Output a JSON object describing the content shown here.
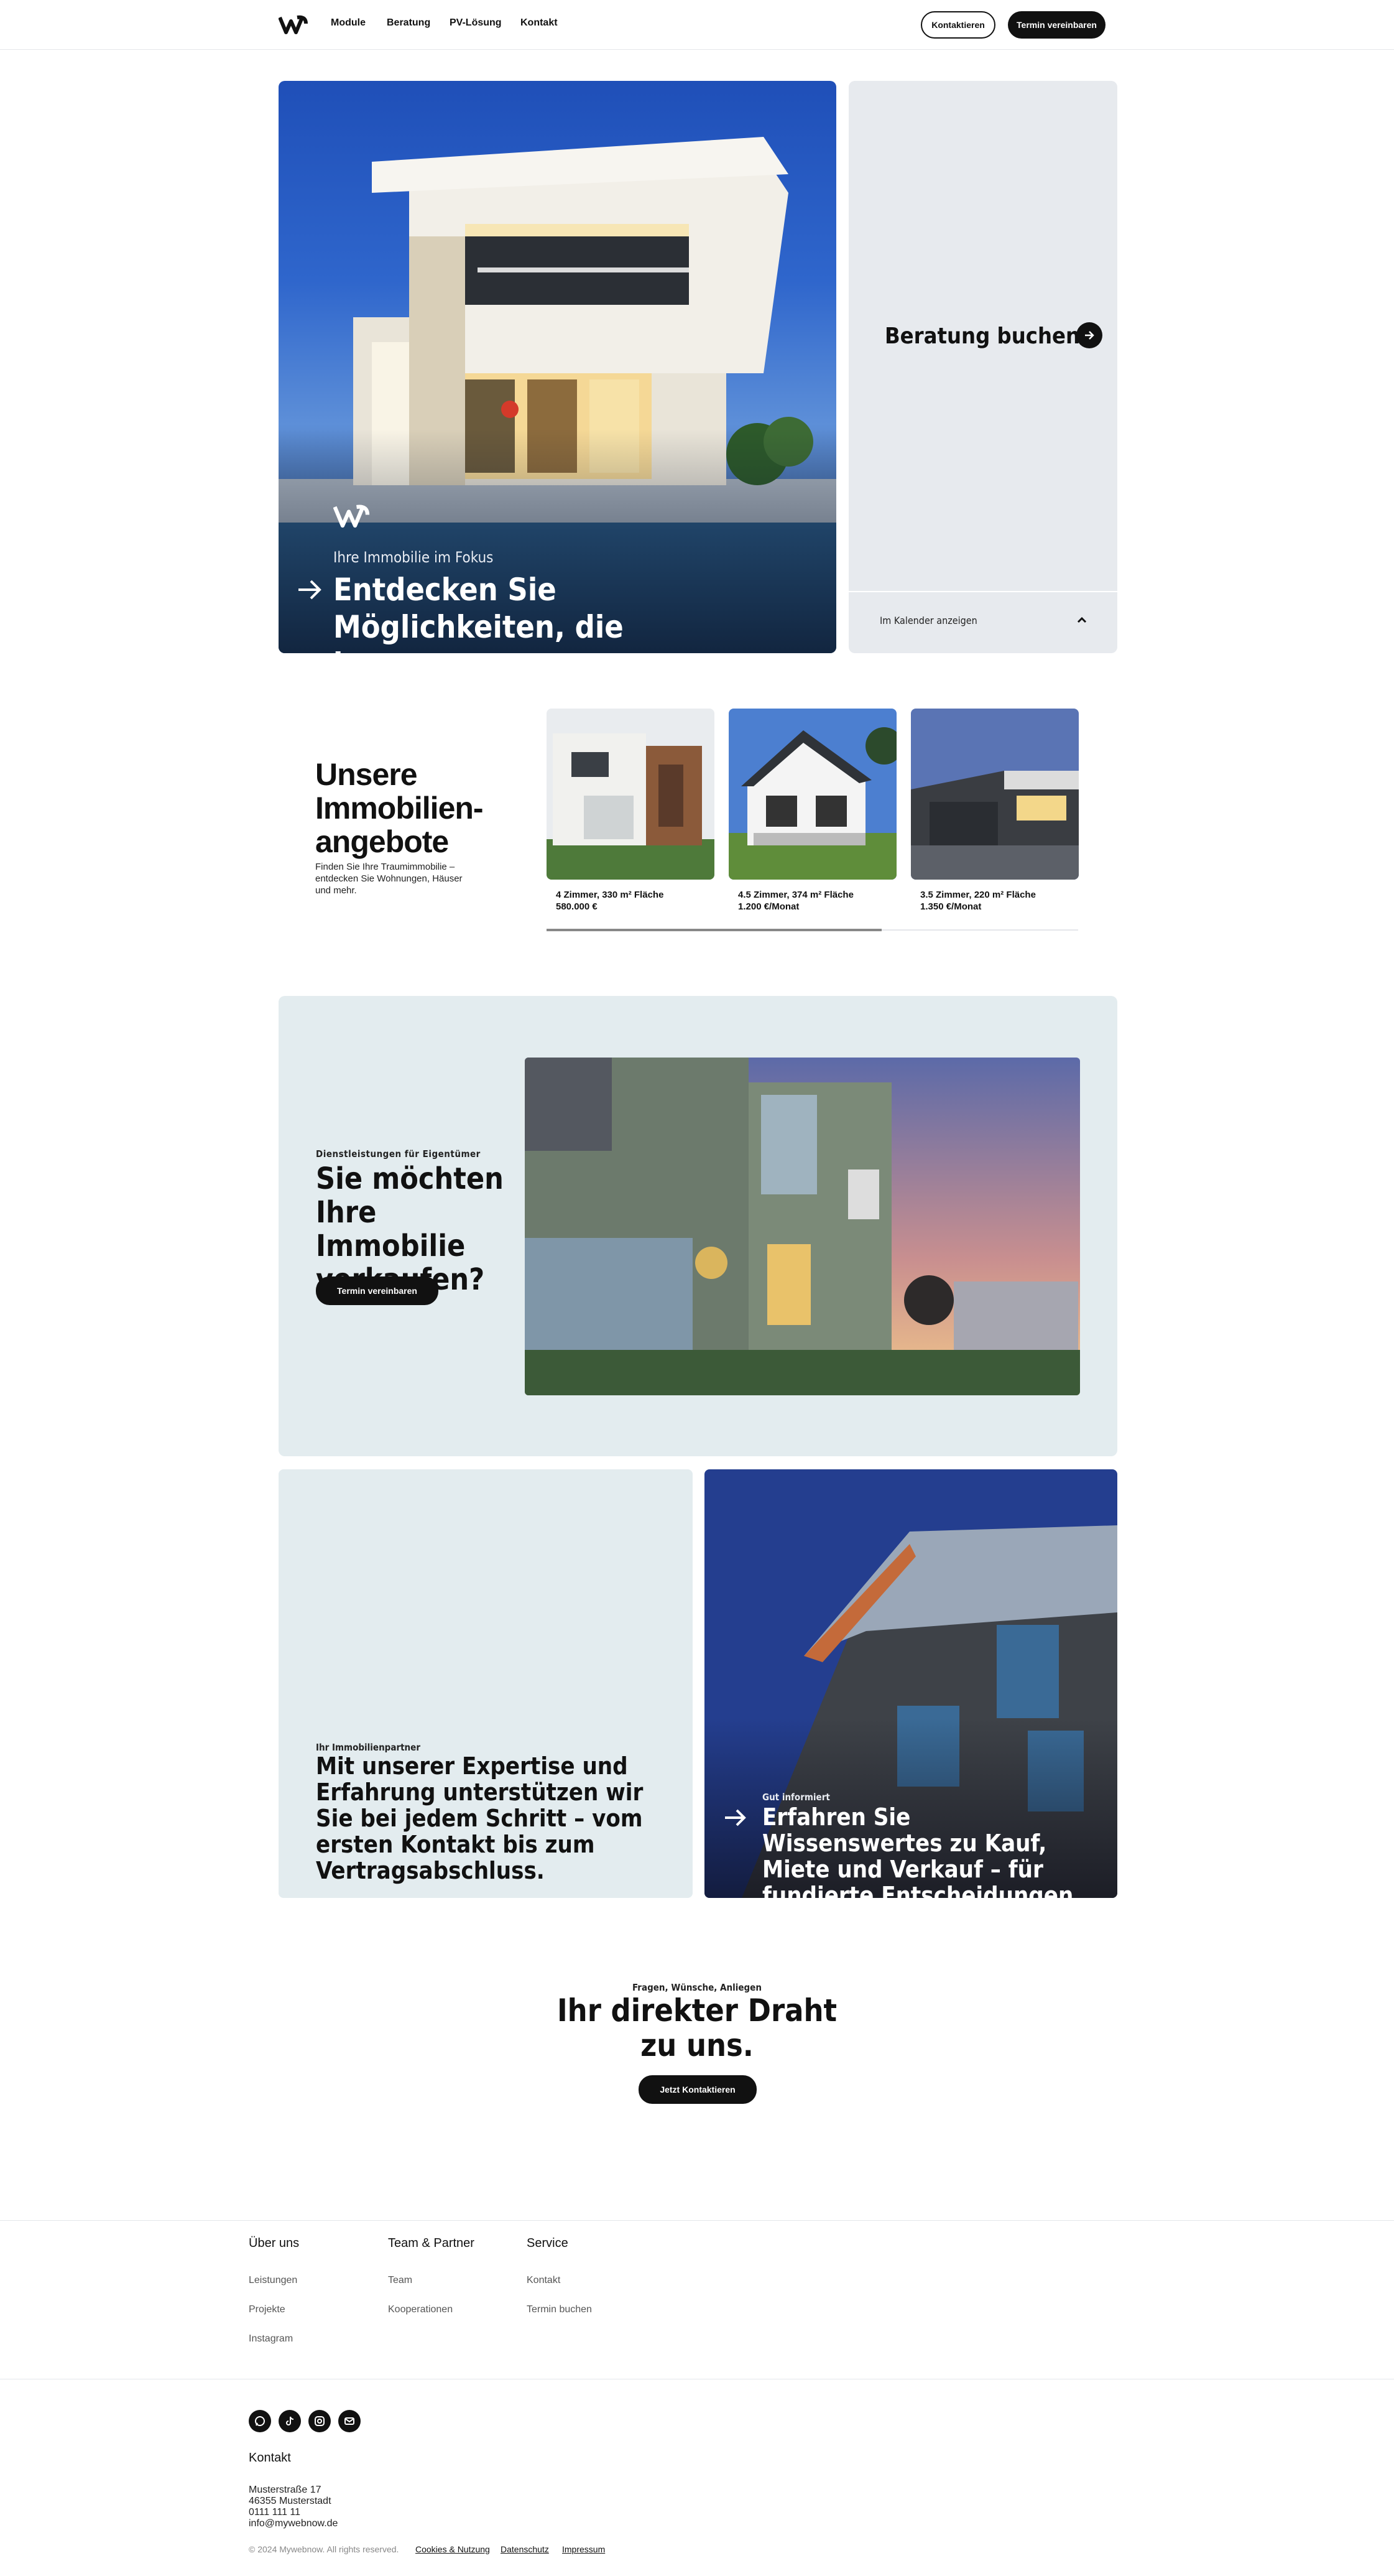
{
  "nav": {
    "links": [
      "Module",
      "Beratung",
      "PV-Lösung",
      "Kontakt"
    ],
    "contact_button": "Kontaktieren",
    "appointment_button": "Termin vereinbaren"
  },
  "hero": {
    "subtitle": "Ihre Immobilie im Fokus",
    "title": "Entdecken Sie Möglichkeiten, die bewegen."
  },
  "booking": {
    "title": "Beratung buchen",
    "calendar_label": "Im Kalender anzeigen"
  },
  "offers": {
    "title": "Unsere Immobilien-angebote",
    "description": "Finden Sie Ihre Traumimmobilie – entdecken Sie Wohnungen, Häuser und mehr.",
    "cards": [
      {
        "details": "4 Zimmer, 330 m² Fläche",
        "price": "580.000 €"
      },
      {
        "details": "4.5 Zimmer, 374 m² Fläche",
        "price": "1.200 €/Monat"
      },
      {
        "details": "3.5 Zimmer, 220 m² Fläche",
        "price": "1.350 €/Monat"
      }
    ],
    "scroll_progress": 0.63
  },
  "sell": {
    "eyebrow": "Dienstleistungen für Eigentümer",
    "title": "Sie möchten Ihre Immobilie verkaufen?",
    "button": "Termin vereinbaren"
  },
  "partner": {
    "eyebrow": "Ihr Immobilienpartner",
    "title": "Mit unserer Expertise und Erfahrung unterstützen wir Sie bei jedem Schritt – vom ersten Kontakt bis zum Vertragsabschluss."
  },
  "info": {
    "eyebrow": "Gut informiert",
    "title": "Erfahren Sie Wissenswertes zu Kauf, Miete und Verkauf – für fundierte Entscheidungen."
  },
  "cta": {
    "eyebrow": "Fragen, Wünsche, Anliegen",
    "title": "Ihr direkter Draht zu uns.",
    "button": "Jetzt Kontaktieren"
  },
  "footer": {
    "columns": [
      {
        "heading": "Über uns",
        "links": [
          "Leistungen",
          "Projekte",
          "Instagram"
        ]
      },
      {
        "heading": "Team & Partner",
        "links": [
          "Team",
          "Kooperationen"
        ]
      },
      {
        "heading": "Service",
        "links": [
          "Kontakt",
          "Termin buchen"
        ]
      }
    ],
    "social_icons": [
      "whatsapp-icon",
      "tiktok-icon",
      "instagram-icon",
      "mail-icon"
    ],
    "contact_heading": "Kontakt",
    "address": [
      "Musterstraße 17",
      "46355 Musterstadt",
      "0111 111 11",
      "info@mywebnow.de"
    ],
    "copyright": "© 2024 Mywebnow. All rights reserved.",
    "legal_links": [
      "Cookies & Nutzung",
      "Datenschutz",
      "Impressum"
    ]
  }
}
